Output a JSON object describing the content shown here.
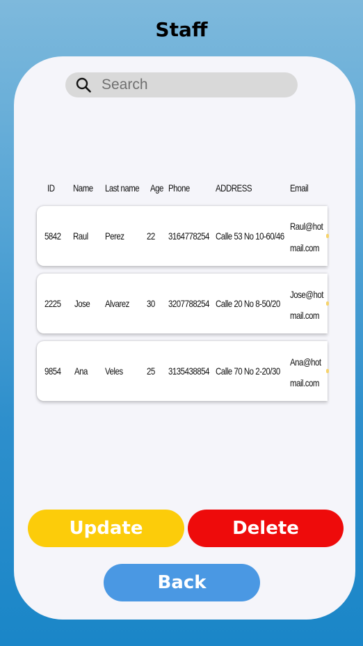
{
  "header": {
    "title": "Staff"
  },
  "search": {
    "placeholder": "Search",
    "value": ""
  },
  "table": {
    "columns": [
      "ID",
      "Name",
      "Last name",
      "Age",
      "Phone",
      "ADDRESS",
      "Email"
    ],
    "rows": [
      {
        "id": "5842",
        "name": "Raul",
        "last_name": "Perez",
        "age": "22",
        "phone": "3164778254",
        "address": "Calle 53 No 10-60/46",
        "email_line1": "Raul@hot",
        "email_line2": "mail.com"
      },
      {
        "id": "2225",
        "name": "Jose",
        "last_name": "Alvarez",
        "age": "30",
        "phone": "3207788254",
        "address": "Calle 20 No 8-50/20",
        "email_line1": "Jose@hot",
        "email_line2": "mail.com"
      },
      {
        "id": "9854",
        "name": "Ana",
        "last_name": "Veles",
        "age": "25",
        "phone": "3135438854",
        "address": "Calle 70 No 2-20/30",
        "email_line1": "Ana@hot",
        "email_line2": "mail.com"
      }
    ]
  },
  "actions": {
    "update_label": "Update",
    "delete_label": "Delete",
    "back_label": "Back"
  },
  "colors": {
    "update": "#fccc0a",
    "delete": "#ee0b0b",
    "back": "#4a98e3",
    "card": "#f5f5fa"
  },
  "icons": {
    "search": "search-icon"
  }
}
